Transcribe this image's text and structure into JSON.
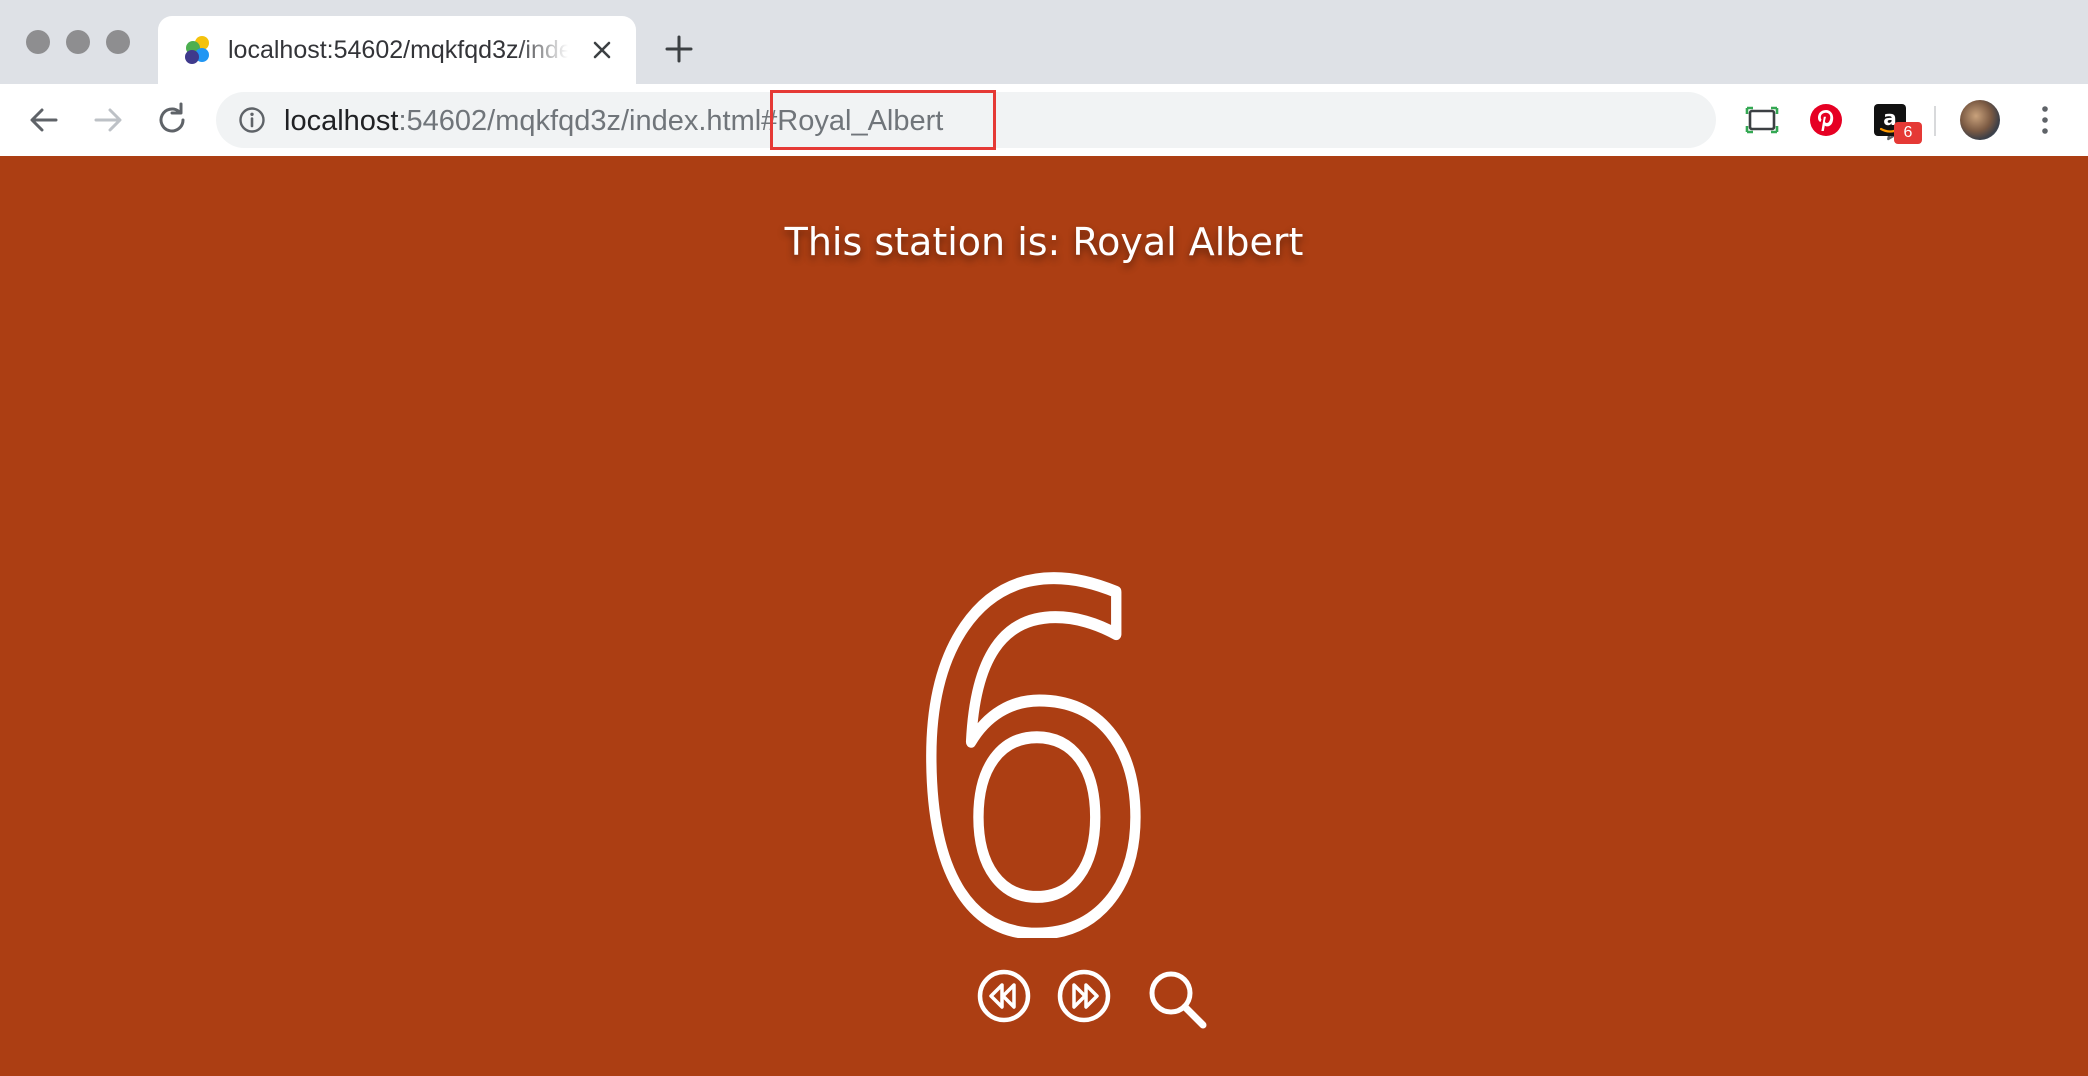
{
  "browser": {
    "tab": {
      "title": "localhost:54602/mqkfqd3z/index.html#Royal_Albert",
      "favicon": "colorful-orbs-favicon"
    },
    "address_bar": {
      "host": "localhost",
      "path": ":54602/mqkfqd3z/index.html#Royal_Albert"
    },
    "extensions": [
      {
        "name": "screen-capture-icon"
      },
      {
        "name": "pinterest-icon",
        "color": "#e60023"
      },
      {
        "name": "amazon-icon",
        "badge": "6"
      }
    ]
  },
  "page": {
    "background_color": "#ac3e13",
    "station_title": "This station is: Royal Albert",
    "station_number": "6",
    "controls": [
      {
        "name": "previous-station-button",
        "icon": "rewind-icon"
      },
      {
        "name": "next-station-button",
        "icon": "fast-forward-icon"
      },
      {
        "name": "search-button",
        "icon": "search-icon"
      }
    ]
  }
}
